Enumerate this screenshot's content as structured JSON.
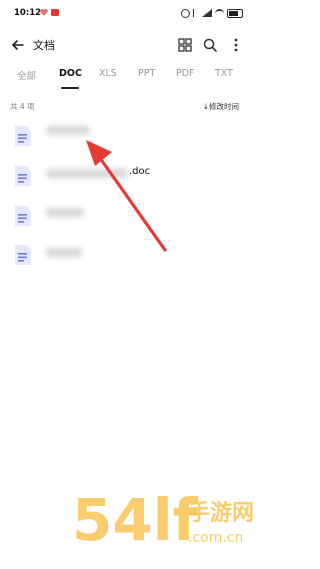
{
  "status_bar": {
    "time": "10:12"
  },
  "header": {
    "title": "文档"
  },
  "tabs": [
    {
      "label": "全部",
      "active": false
    },
    {
      "label": "DOC",
      "active": true
    },
    {
      "label": "XLS",
      "active": false
    },
    {
      "label": "PPT",
      "active": false
    },
    {
      "label": "PDF",
      "active": false
    },
    {
      "label": "TXT",
      "active": false
    }
  ],
  "list": {
    "count_label": "共 4 项",
    "sort_label": "↓修改时间",
    "items": [
      {
        "name": ""
      },
      {
        "name": ".doc"
      },
      {
        "name": ""
      },
      {
        "name": ""
      }
    ]
  },
  "watermark": {
    "logo": "54lf",
    "site_name": "手游网",
    "domain": ".com.cn"
  },
  "colors": {
    "accent": "#e53935",
    "file_icon": "#6b7fd7",
    "watermark": "#f7c04a"
  }
}
